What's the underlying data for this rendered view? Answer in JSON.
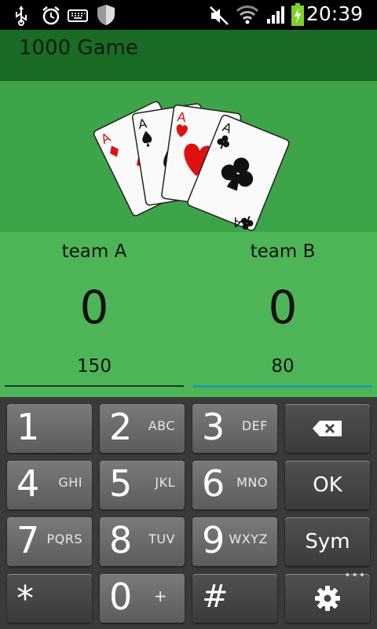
{
  "status_bar": {
    "time": "20:39",
    "icons": [
      "usb-icon",
      "alarm-icon",
      "keyboard-icon",
      "shield-icon",
      "mute-icon",
      "wifi-icon",
      "signal-icon",
      "battery-charging-icon"
    ]
  },
  "app_bar": {
    "title": "1000 Game"
  },
  "team_a": {
    "name": "team A",
    "score": "0",
    "input_value": "150"
  },
  "team_b": {
    "name": "team B",
    "score": "0",
    "input_value": "80"
  },
  "keypad": {
    "k1": {
      "num": "1",
      "sub": ""
    },
    "k2": {
      "num": "2",
      "sub": "ABC"
    },
    "k3": {
      "num": "3",
      "sub": "DEF"
    },
    "k4": {
      "num": "4",
      "sub": "GHI"
    },
    "k5": {
      "num": "5",
      "sub": "JKL"
    },
    "k6": {
      "num": "6",
      "sub": "MNO"
    },
    "k7": {
      "num": "7",
      "sub": "PQRS"
    },
    "k8": {
      "num": "8",
      "sub": "TUV"
    },
    "k9": {
      "num": "9",
      "sub": "WXYZ"
    },
    "k0": {
      "num": "0",
      "sub": "+"
    },
    "star": "*",
    "hash": "#",
    "ok": "OK",
    "sym": "Sym",
    "dots": "•••"
  },
  "colors": {
    "app_bar": "#1a6b24",
    "hero_bg": "#3ea449",
    "score_bg": "#4db557",
    "focus_underline": "#1e9aa3"
  }
}
